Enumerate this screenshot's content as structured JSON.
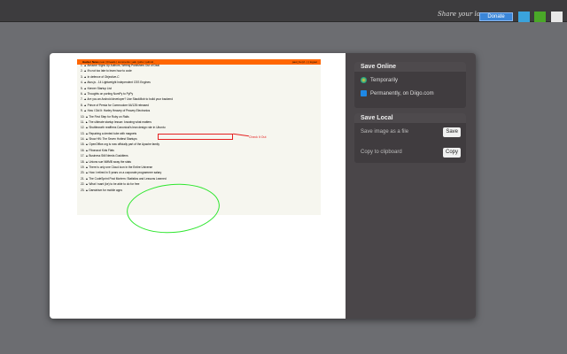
{
  "topbar": {
    "share_text": "Share your love...",
    "donate": "Donate",
    "icons": [
      "twitter-icon",
      "facebook-like-icon",
      "mail-icon"
    ]
  },
  "screenshot": {
    "header": {
      "title": "Hacker News",
      "nav": "new | threads | comments | ask | jobs | submit",
      "user": "paul_bu (2...) | logout"
    },
    "items": [
      "Amazon Signs Up Authors, Writing Publishers Out of Deal",
      "It's not too late to learn how to code",
      "In defence of Objective-C",
      "Atus.js - 14 Lightweight Independent CSS Engines",
      "Kenner Startup List",
      "Thoughts on porting NumPy to PyPy",
      "Are you an Android developer? Use StackMob to build your backend",
      "Prince of Persia for Commodore 64/128 released",
      "How I Did It: Harley Heavey of Peavey Electronics",
      "The First Step for Ruby on Rails",
      "The ultimate startup lesson: knowing what matters",
      "Shuttleworth reaffirms Canonical's lean design role in Ubuntu",
      "Repairing a dented tube with magnets",
      "Show HN: The Seven Hottest Startups",
      "OpenOffice.org is now officially part of the Apache family",
      "Fibonacci Kids Flats",
      "Business Still Needs Gusldtens",
      "Unions sue NMMB sway the stats",
      "There is only one Cloud icon in the Entire Universe",
      "How I retired in 5 years on a corporate programmer salary",
      "The CodeSprint Post Mortem: Statistics and Lessons Learned",
      "What I want (ke) to be able to do for free",
      "Darwinism for mobile apps"
    ],
    "annotation": "Check It Out"
  },
  "panel": {
    "save_online": {
      "title": "Save Online",
      "temporarily": "Temporarily",
      "permanently": "Permanently, on Diigo.com"
    },
    "save_local": {
      "title": "Save Local",
      "save_label": "Save image as a file",
      "save_button": "Save",
      "copy_label": "Copy to clipboard",
      "copy_button": "Copy"
    }
  }
}
